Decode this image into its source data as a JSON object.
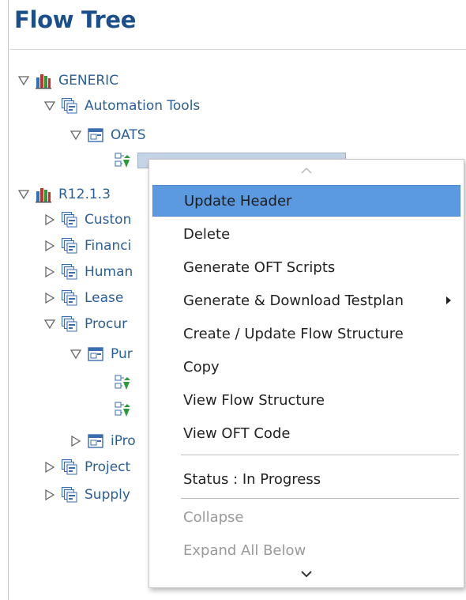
{
  "title": "Flow Tree",
  "tree": {
    "generic": "GENERIC",
    "automation_tools": "Automation Tools",
    "oats": "OATS",
    "selected_flow": "",
    "r12": "R12.1.3",
    "customer": "Custon",
    "financials": "Financi",
    "human": "Human",
    "lease": "Lease",
    "procurement": "Procur",
    "purchasing": "Pur",
    "iproc": "iPro",
    "projects": "Project",
    "supply": "Supply"
  },
  "context_menu": {
    "items": [
      "Update Header",
      "Delete",
      "Generate OFT Scripts",
      "Generate & Download Testplan",
      "Create / Update Flow Structure",
      "Copy",
      "View Flow Structure",
      "View OFT Code"
    ],
    "status": "Status : In Progress",
    "collapse": "Collapse",
    "expand_all_below": "Expand All Below"
  },
  "colors": {
    "title": "#1a4f8b",
    "tree_text": "#2b5f97",
    "menu_highlight": "#5b9ae0",
    "disabled_text": "#9a9a9a"
  }
}
